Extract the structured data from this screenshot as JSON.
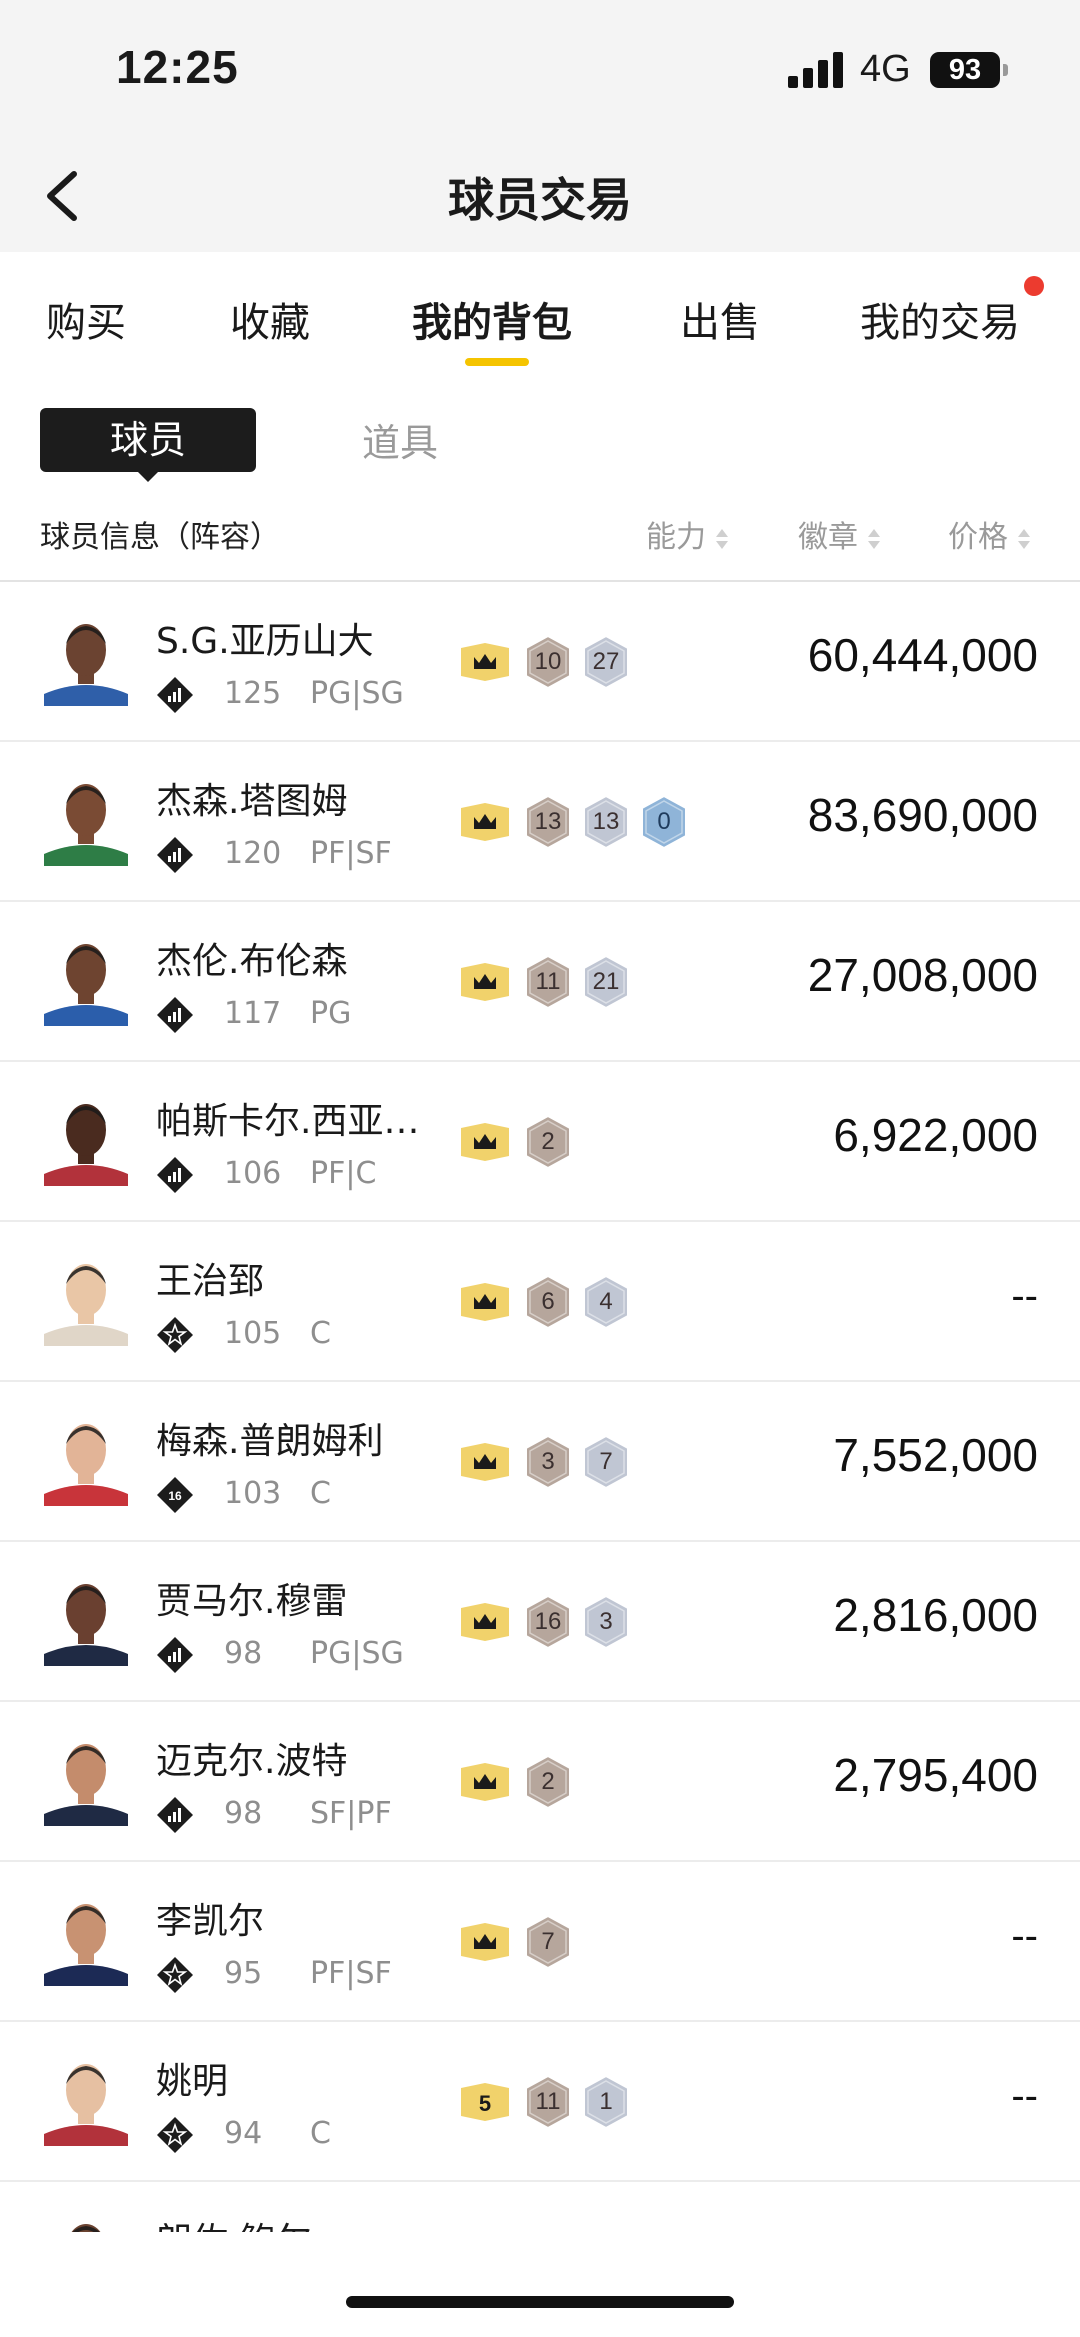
{
  "status": {
    "time": "12:25",
    "network": "4G",
    "battery": "93"
  },
  "nav": {
    "title": "球员交易"
  },
  "tabs": [
    {
      "label": "购买",
      "active": false
    },
    {
      "label": "收藏",
      "active": false
    },
    {
      "label": "我的背包",
      "active": true
    },
    {
      "label": "出售",
      "active": false
    },
    {
      "label": "我的交易",
      "active": false,
      "notify": true
    }
  ],
  "subtabs": {
    "player": "球员",
    "item": "道具"
  },
  "columns": {
    "info": "球员信息（阵容）",
    "ability": "能力",
    "badge": "徽章",
    "price": "价格"
  },
  "badge_colors": {
    "bronze": "#b6a69c",
    "silver": "#c0c6d3",
    "blue": "#8fb4d8",
    "gold": "#f1d26b"
  },
  "players": [
    {
      "name": "S.G.亚历山大",
      "ovr": "125",
      "pos": "PG|SG",
      "tier": "chart",
      "ability": "crown",
      "badges": [
        {
          "n": "10",
          "c": "bronze"
        },
        {
          "n": "27",
          "c": "silver"
        }
      ],
      "price": "60,444,000",
      "skin": "#6b4331",
      "jersey": "#2f5fa9"
    },
    {
      "name": "杰森.塔图姆",
      "ovr": "120",
      "pos": "PF|SF",
      "tier": "chart",
      "ability": "crown",
      "badges": [
        {
          "n": "13",
          "c": "bronze"
        },
        {
          "n": "13",
          "c": "silver"
        },
        {
          "n": "0",
          "c": "blue"
        }
      ],
      "price": "83,690,000",
      "skin": "#7a4b34",
      "jersey": "#2e7d46"
    },
    {
      "name": "杰伦.布伦森",
      "ovr": "117",
      "pos": "PG",
      "tier": "chart",
      "ability": "crown",
      "badges": [
        {
          "n": "11",
          "c": "bronze"
        },
        {
          "n": "21",
          "c": "silver"
        }
      ],
      "price": "27,008,000",
      "skin": "#6e4430",
      "jersey": "#2b5eab"
    },
    {
      "name": "帕斯卡尔.西亚卡姆",
      "ovr": "106",
      "pos": "PF|C",
      "tier": "chart",
      "ability": "crown",
      "badges": [
        {
          "n": "2",
          "c": "bronze"
        }
      ],
      "price": "6,922,000",
      "skin": "#4a2b1f",
      "jersey": "#b2323b"
    },
    {
      "name": "王治郅",
      "ovr": "105",
      "pos": "C",
      "tier": "star",
      "ability": "crown",
      "badges": [
        {
          "n": "6",
          "c": "bronze"
        },
        {
          "n": "4",
          "c": "silver"
        }
      ],
      "price": "--",
      "skin": "#e9c6a6",
      "jersey": "#e0d6c8"
    },
    {
      "name": "梅森.普朗姆利",
      "ovr": "103",
      "pos": "C",
      "tier": "16",
      "ability": "crown",
      "badges": [
        {
          "n": "3",
          "c": "bronze"
        },
        {
          "n": "7",
          "c": "silver"
        }
      ],
      "price": "7,552,000",
      "skin": "#e2b497",
      "jersey": "#c8343a"
    },
    {
      "name": "贾马尔.穆雷",
      "ovr": "98",
      "pos": "PG|SG",
      "tier": "chart",
      "ability": "crown",
      "badges": [
        {
          "n": "16",
          "c": "bronze"
        },
        {
          "n": "3",
          "c": "silver"
        }
      ],
      "price": "2,816,000",
      "skin": "#6a4030",
      "jersey": "#1f2a44"
    },
    {
      "name": "迈克尔.波特",
      "ovr": "98",
      "pos": "SF|PF",
      "tier": "chart",
      "ability": "crown",
      "badges": [
        {
          "n": "2",
          "c": "bronze"
        }
      ],
      "price": "2,795,400",
      "skin": "#c48c6c",
      "jersey": "#1f2a44"
    },
    {
      "name": "李凯尔",
      "ovr": "95",
      "pos": "PF|SF",
      "tier": "star",
      "ability": "crown",
      "badges": [
        {
          "n": "7",
          "c": "bronze"
        }
      ],
      "price": "--",
      "skin": "#c89272",
      "jersey": "#1c2a55"
    },
    {
      "name": "姚明",
      "ovr": "94",
      "pos": "C",
      "tier": "star",
      "ability": "5",
      "badges": [
        {
          "n": "11",
          "c": "bronze"
        },
        {
          "n": "1",
          "c": "silver"
        }
      ],
      "price": "--",
      "skin": "#e6c0a2",
      "jersey": "#b2323b"
    },
    {
      "name": "朗佐.鲍尔",
      "ovr": "",
      "pos": "",
      "tier": "chart",
      "ability": "crown",
      "badges": [],
      "price": "",
      "skin": "#6b4331",
      "jersey": "#333"
    }
  ]
}
